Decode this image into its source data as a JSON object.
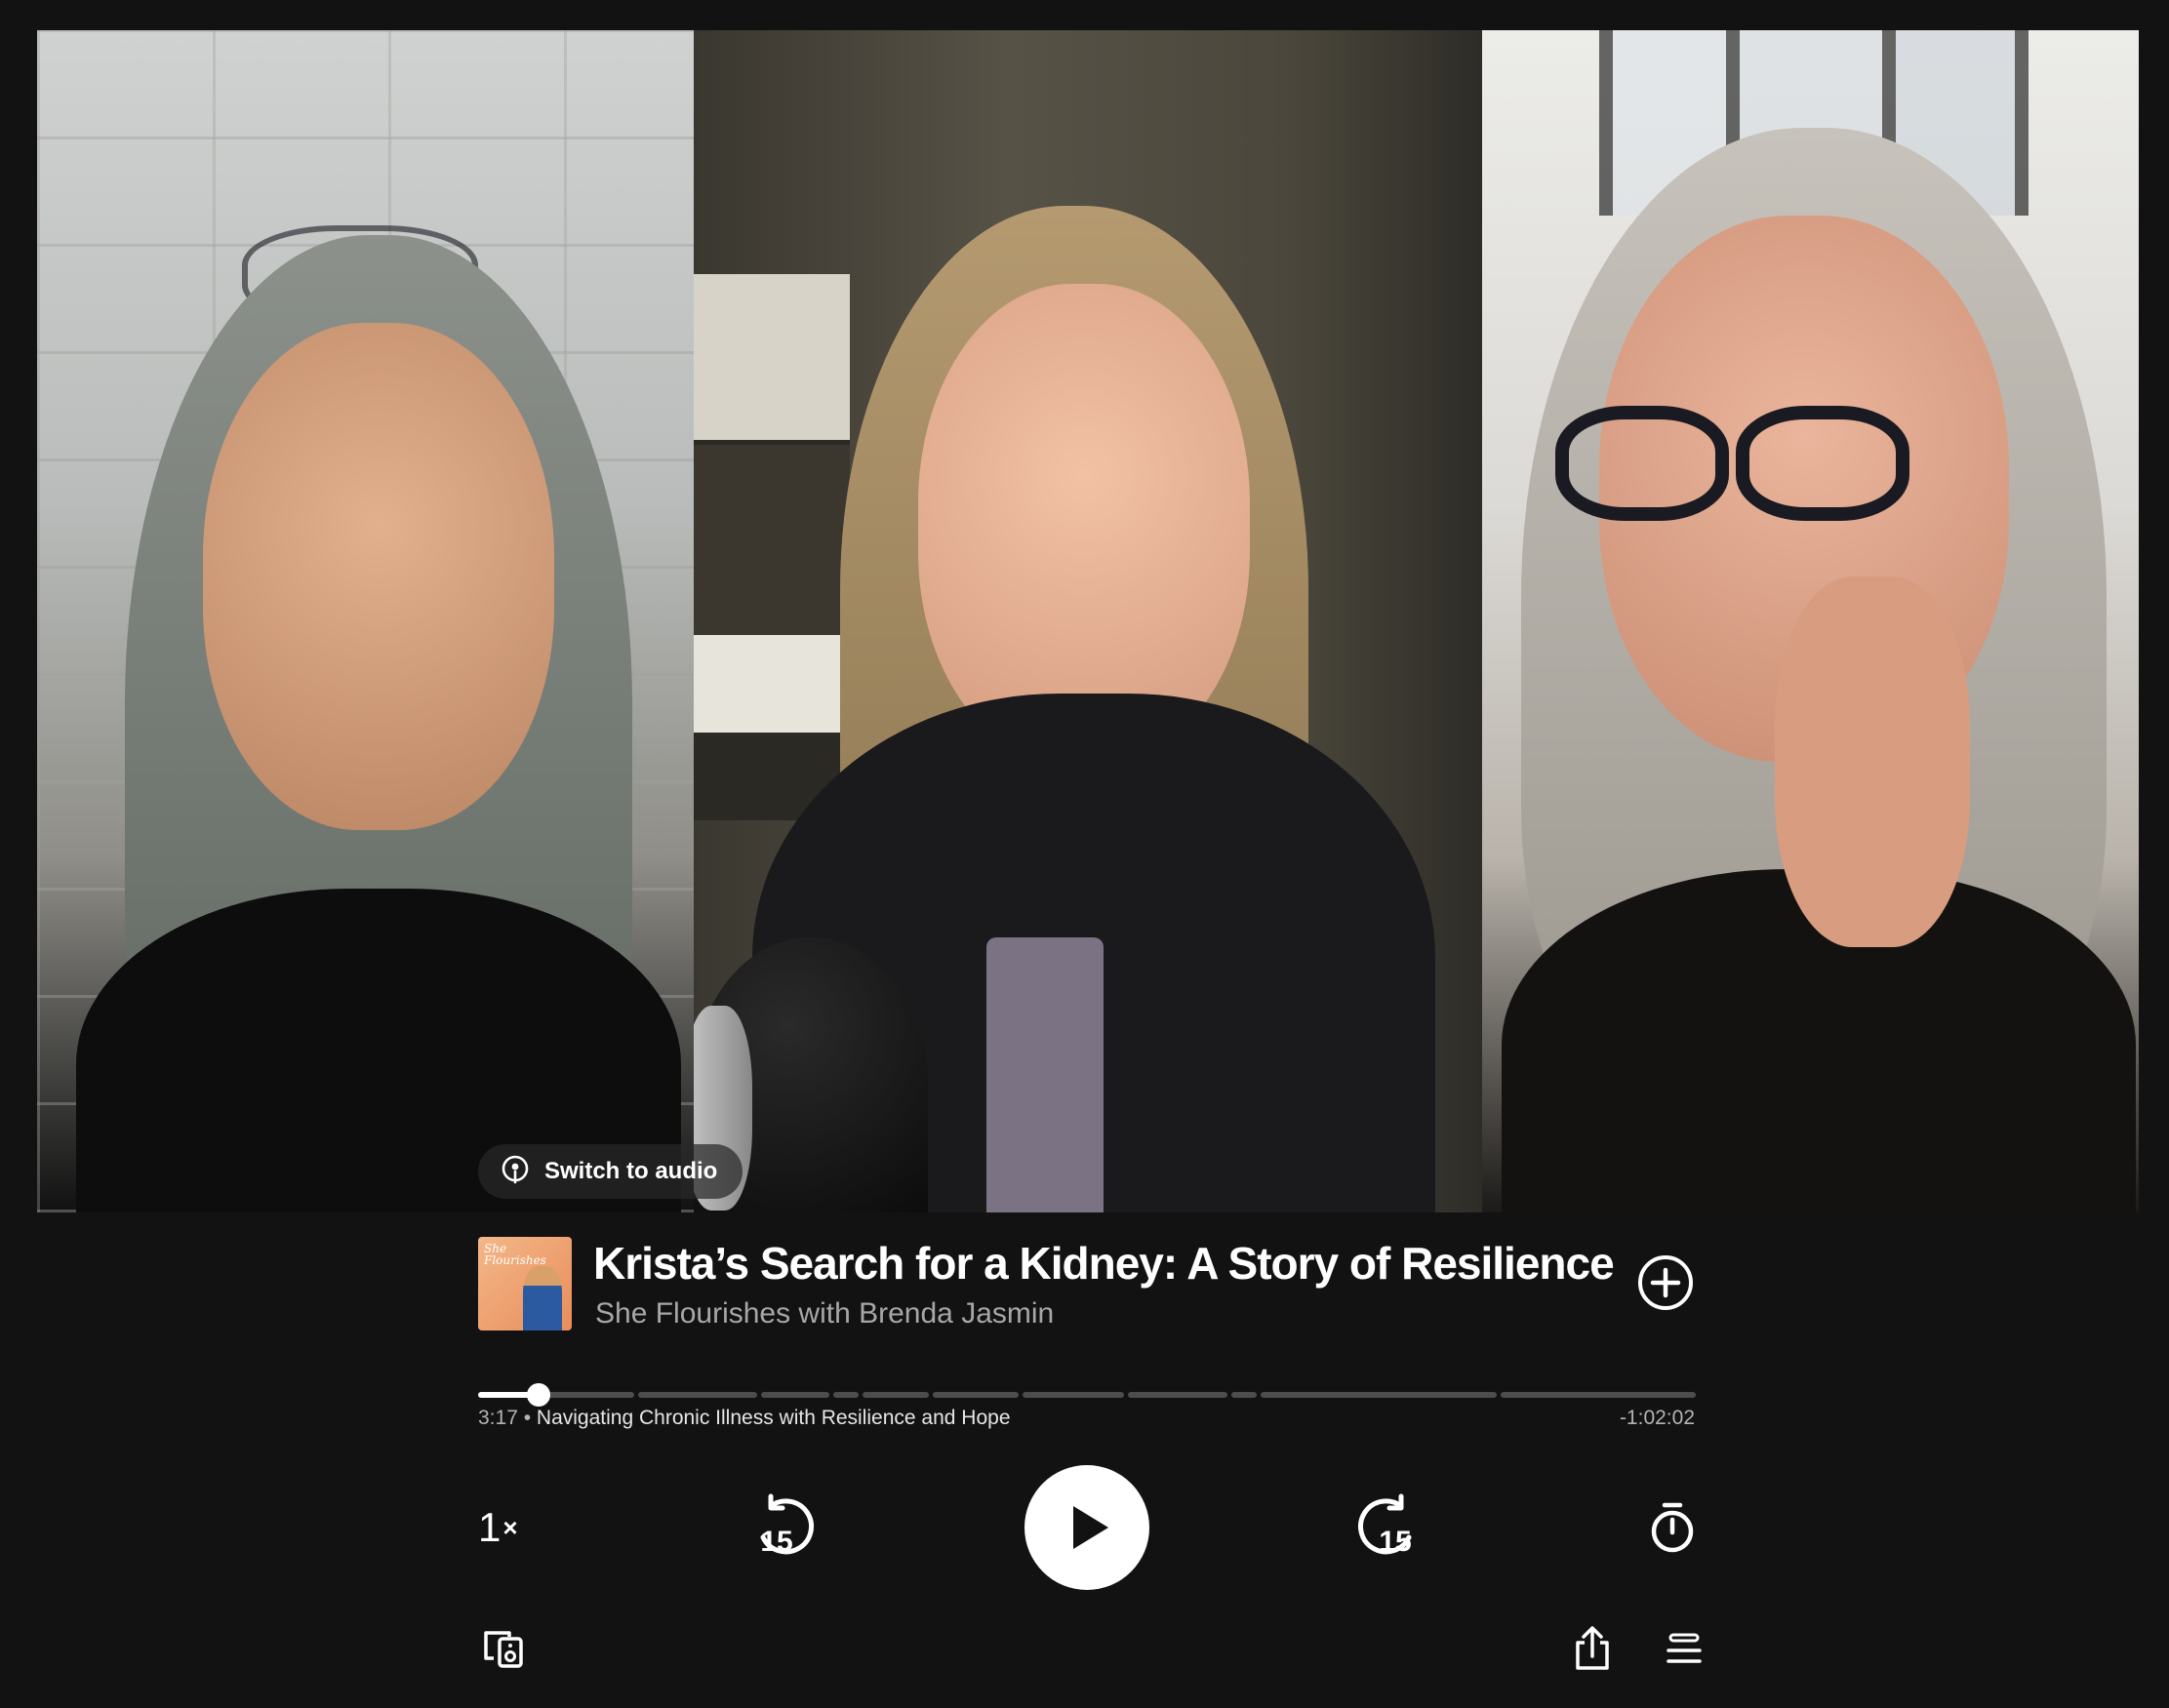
{
  "video": {
    "switch_audio_label": "Switch to audio"
  },
  "episode": {
    "title": "Krista’s Search for a Kidney: A Story of Resilience",
    "show": "She Flourishes with Brenda Jasmin",
    "artwork_text": "She Flourishes"
  },
  "playback": {
    "progress_fraction": 0.05,
    "elapsed": "3:17",
    "separator": "•",
    "chapter": "Navigating Chronic Illness with Resilience and Hope",
    "remaining": "-1:02:02",
    "speed": "1",
    "speed_suffix": "×",
    "skip_back_seconds": "15",
    "skip_forward_seconds": "15"
  },
  "icons": {
    "switch_audio": "podcast-icon",
    "add": "add-circle-icon",
    "play": "play-icon",
    "skip_back": "skip-back-15-icon",
    "skip_forward": "skip-forward-15-icon",
    "sleep_timer": "timer-icon",
    "connect_device": "connect-device-icon",
    "share": "share-icon",
    "queue": "queue-icon"
  },
  "colors": {
    "background": "#121212",
    "primary_text": "#ffffff",
    "secondary_text": "#a7a7a7",
    "track": "#4d4d4d"
  }
}
